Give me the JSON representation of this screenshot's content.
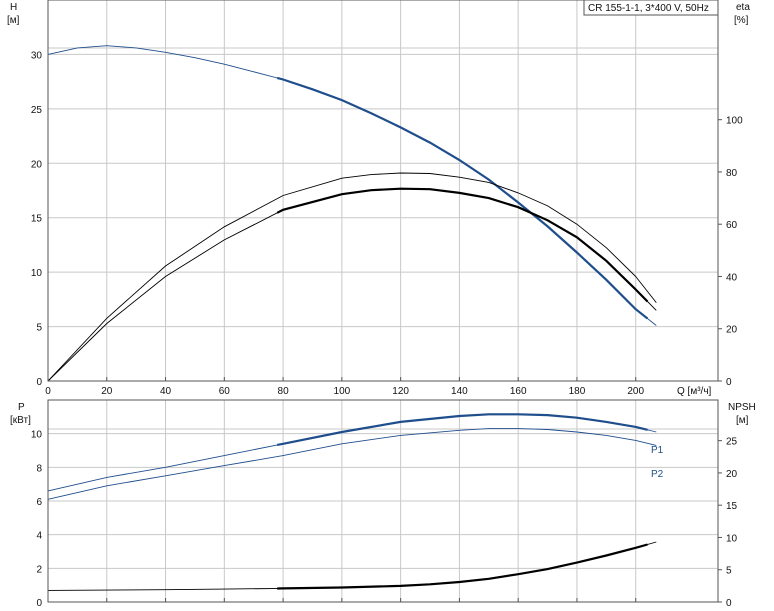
{
  "colors": {
    "pump_curve": "#1f4e8c",
    "black": "#000000",
    "grid": "#c8c8c8"
  },
  "chart_data": [
    {
      "type": "line",
      "title": "CR 155-1-1, 3*400 V, 50Hz",
      "xlabel": "Q [м³/ч]",
      "ylabel_left": {
        "name": "H",
        "unit": "[м]"
      },
      "ylabel_right": {
        "name": "eta",
        "unit": "[%]"
      },
      "xlim": [
        0,
        228
      ],
      "ylim_left": [
        0,
        35
      ],
      "ylim_right": [
        0,
        145.8
      ],
      "x_ticks": [
        0,
        20,
        40,
        60,
        80,
        100,
        120,
        140,
        160,
        180,
        200
      ],
      "y_ticks_left": [
        0,
        5,
        10,
        15,
        20,
        25,
        30
      ],
      "y_ticks_right": [
        0,
        20,
        40,
        60,
        80,
        100
      ],
      "grid": true,
      "series": [
        {
          "name": "H",
          "axis": "left",
          "color": "#1f4e8c",
          "x": [
            0,
            10,
            20,
            30,
            40,
            50,
            60,
            70,
            80,
            90,
            100,
            110,
            120,
            130,
            140,
            150,
            160,
            170,
            180,
            190,
            200,
            207
          ],
          "y": [
            30,
            30.6,
            30.8,
            30.6,
            30.2,
            29.7,
            29.1,
            28.4,
            27.7,
            26.8,
            25.8,
            24.6,
            23.3,
            21.9,
            20.3,
            18.5,
            16.4,
            14.2,
            11.8,
            9.3,
            6.6,
            5.1
          ],
          "emphasis_range": [
            78,
            204
          ]
        },
        {
          "name": "eta_upper",
          "axis": "right",
          "color": "#000000",
          "x": [
            0,
            20,
            40,
            60,
            80,
            100,
            110,
            120,
            130,
            140,
            150,
            160,
            170,
            180,
            190,
            200,
            207
          ],
          "y": [
            0,
            24,
            44,
            59,
            71,
            77.6,
            79,
            79.6,
            79.4,
            78,
            76,
            72,
            67,
            60,
            51,
            40,
            30
          ]
        },
        {
          "name": "eta",
          "axis": "right",
          "color": "#000000",
          "x": [
            0,
            20,
            40,
            60,
            80,
            100,
            110,
            120,
            130,
            140,
            150,
            160,
            170,
            180,
            190,
            200,
            207
          ],
          "y": [
            0,
            22,
            40,
            54,
            65.5,
            71.5,
            73,
            73.6,
            73.4,
            72,
            70,
            66.5,
            61.5,
            55,
            46,
            35,
            27
          ],
          "emphasis_range": [
            78,
            204
          ]
        }
      ]
    },
    {
      "type": "line",
      "xlabel": "",
      "ylabel_left": {
        "name": "P",
        "unit": "[кВт]"
      },
      "ylabel_right": {
        "name": "NPSH",
        "unit": "[м]"
      },
      "xlim": [
        0,
        228
      ],
      "ylim_left": [
        0,
        12
      ],
      "ylim_right": [
        0,
        31.3
      ],
      "x_ticks": [
        0,
        20,
        40,
        60,
        80,
        100,
        120,
        140,
        160,
        180,
        200
      ],
      "y_ticks_left": [
        0,
        2,
        4,
        6,
        8,
        10
      ],
      "y_ticks_right": [
        0,
        5,
        10,
        15,
        20,
        25
      ],
      "grid": true,
      "series": [
        {
          "name": "P1",
          "axis": "left",
          "color": "#1f4e8c",
          "x": [
            0,
            20,
            40,
            60,
            80,
            100,
            120,
            140,
            150,
            160,
            170,
            180,
            190,
            200,
            207
          ],
          "y": [
            6.6,
            7.4,
            8.0,
            8.7,
            9.4,
            10.1,
            10.7,
            11.05,
            11.15,
            11.15,
            11.1,
            10.95,
            10.7,
            10.4,
            10.1
          ],
          "emphasis_range": [
            78,
            204
          ]
        },
        {
          "name": "P2",
          "axis": "left",
          "color": "#1f4e8c",
          "x": [
            0,
            20,
            40,
            60,
            80,
            100,
            120,
            140,
            150,
            160,
            170,
            180,
            190,
            200,
            207
          ],
          "y": [
            6.1,
            6.9,
            7.5,
            8.1,
            8.7,
            9.4,
            9.9,
            10.2,
            10.3,
            10.3,
            10.25,
            10.1,
            9.9,
            9.6,
            9.3
          ]
        },
        {
          "name": "NPSH",
          "axis": "right",
          "color": "#000000",
          "x": [
            0,
            20,
            40,
            60,
            80,
            100,
            120,
            130,
            140,
            150,
            160,
            170,
            180,
            190,
            200,
            207
          ],
          "y": [
            1.8,
            1.85,
            1.9,
            2.0,
            2.1,
            2.25,
            2.5,
            2.75,
            3.1,
            3.6,
            4.3,
            5.1,
            6.1,
            7.2,
            8.4,
            9.3
          ],
          "emphasis_range": [
            78,
            204
          ]
        }
      ]
    }
  ]
}
